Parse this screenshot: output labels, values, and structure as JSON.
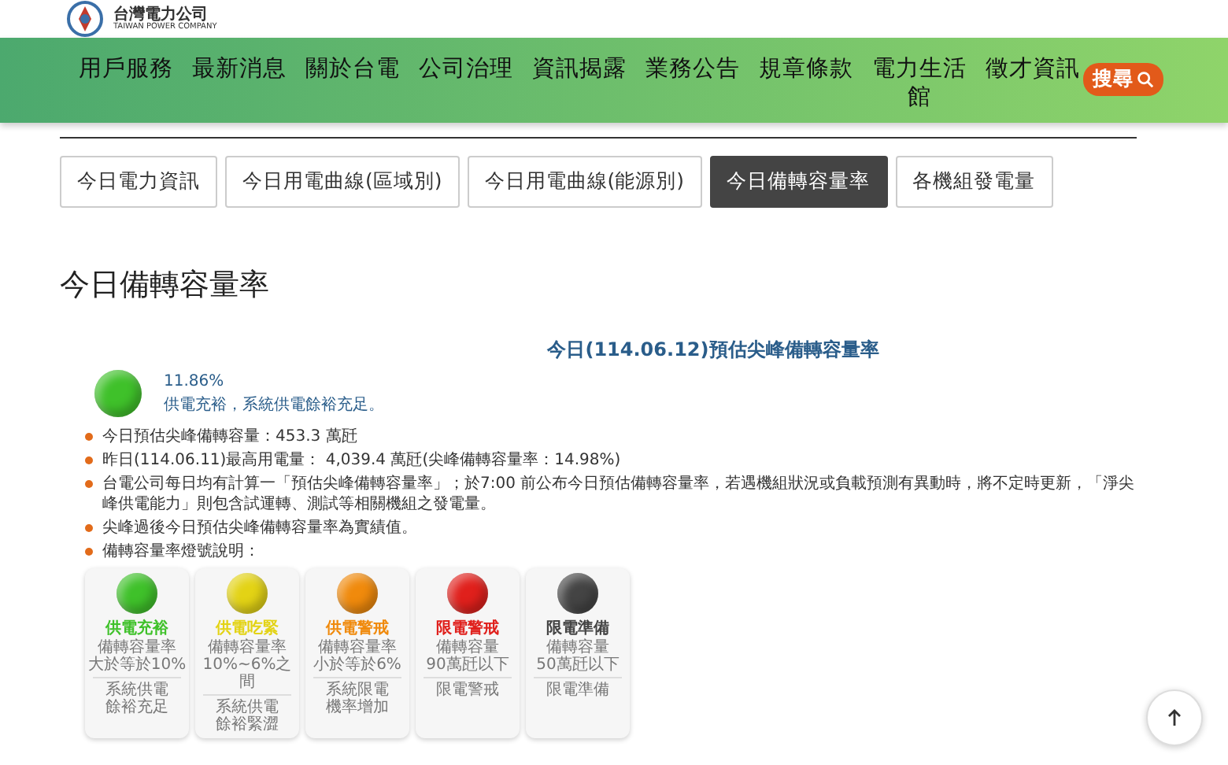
{
  "header": {
    "logo_name": "台灣電力公司",
    "logo_subtitle": "TAIWAN POWER COMPANY"
  },
  "nav": {
    "items": [
      "用戶服務",
      "最新消息",
      "關於台電",
      "公司治理",
      "資訊揭露",
      "業務公告",
      "規章條款",
      "電力生活館",
      "徵才資訊"
    ],
    "search": "搜尋"
  },
  "tabs": [
    {
      "label": "今日電力資訊",
      "selected": false
    },
    {
      "label": "今日用電曲線(區域別)",
      "selected": false
    },
    {
      "label": "今日用電曲線(能源別)",
      "selected": false
    },
    {
      "label": "今日備轉容量率",
      "selected": true
    },
    {
      "label": "各機組發電量",
      "selected": false
    }
  ],
  "heading": "今日備轉容量率",
  "chart_title": "今日(114.06.12)預估尖峰備轉容量率",
  "status": {
    "percent": "11.86%",
    "message": "供電充裕，系統供電餘裕充足。",
    "color": "#3fc12a"
  },
  "bullets": [
    "今日預估尖峰備轉容量：453.3 萬瓩",
    "昨日(114.06.11)最高用電量： 4,039.4 萬瓩(尖峰備轉容量率：14.98%)",
    "台電公司每日均有計算一「預估尖峰備轉容量率」；於7:00 前公布今日預估備轉容量率，若遇機組狀況或負載預測有異動時，將不定時更新，「淨尖峰供電能力」則包含試運轉、測試等相關機組之發電量。",
    "尖峰過後今日預估尖峰備轉容量率為實績值。",
    "備轉容量率燈號說明："
  ],
  "legend": [
    {
      "title": "供電充裕",
      "color": "#3fc12a",
      "lines": [
        "備轉容量率",
        "大於等於10%"
      ],
      "note": [
        "系統供電",
        "餘裕充足"
      ]
    },
    {
      "title": "供電吃緊",
      "color": "#e3d315",
      "lines": [
        "備轉容量率",
        "10%~6%之間"
      ],
      "note": [
        "系統供電",
        "餘裕緊澀"
      ]
    },
    {
      "title": "供電警戒",
      "color": "#f08a0c",
      "lines": [
        "備轉容量率",
        "小於等於6%"
      ],
      "note": [
        "系統限電",
        "機率增加"
      ]
    },
    {
      "title": "限電警戒",
      "color": "#e0201c",
      "lines": [
        "備轉容量",
        "90萬瓩以下"
      ],
      "note": [
        "限電警戒"
      ]
    },
    {
      "title": "限電準備",
      "color": "#444444",
      "lines": [
        "備轉容量",
        "50萬瓩以下"
      ],
      "note": [
        "限電準備"
      ]
    }
  ]
}
